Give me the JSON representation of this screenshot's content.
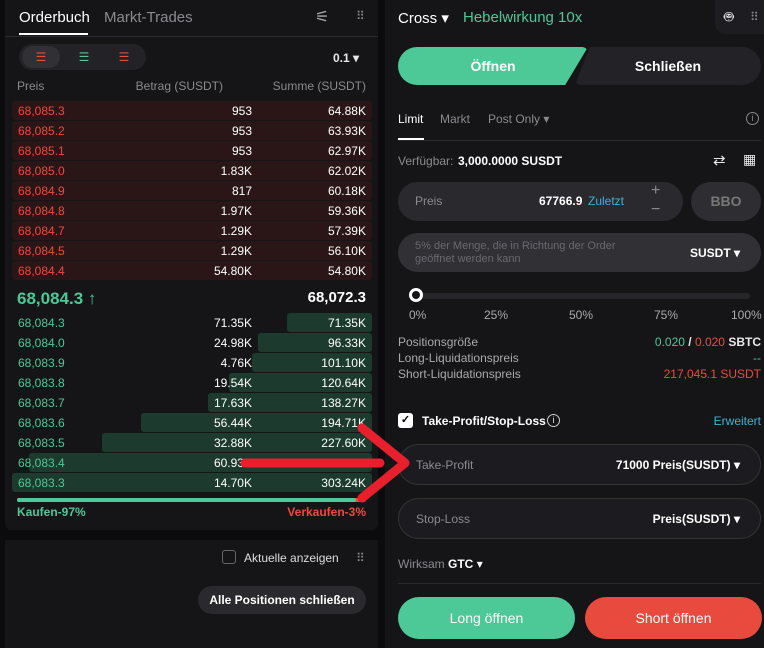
{
  "orderbook": {
    "tabs": [
      "Orderbuch",
      "Markt-Trades"
    ],
    "precision": "0.1",
    "headers": [
      "Preis",
      "Betrag (SUSDT)",
      "Summe (SUSDT)"
    ],
    "asks": [
      [
        "68,085.3",
        "953",
        "64.88K"
      ],
      [
        "68,085.2",
        "953",
        "63.93K"
      ],
      [
        "68,085.1",
        "953",
        "62.97K"
      ],
      [
        "68,085.0",
        "1.83K",
        "62.02K"
      ],
      [
        "68,084.9",
        "817",
        "60.18K"
      ],
      [
        "68,084.8",
        "1.97K",
        "59.36K"
      ],
      [
        "68,084.7",
        "1.29K",
        "57.39K"
      ],
      [
        "68,084.5",
        "1.29K",
        "56.10K"
      ],
      [
        "68,084.4",
        "54.80K",
        "54.80K"
      ]
    ],
    "last_price": "68,084.3",
    "mark_price": "68,072.3",
    "bids": [
      [
        "68,084.3",
        "71.35K",
        "71.35K"
      ],
      [
        "68,084.0",
        "24.98K",
        "96.33K"
      ],
      [
        "68,083.9",
        "4.76K",
        "101.10K"
      ],
      [
        "68,083.8",
        "19.54K",
        "120.64K"
      ],
      [
        "68,083.7",
        "17.63K",
        "138.27K"
      ],
      [
        "68,083.6",
        "56.44K",
        "194.71K"
      ],
      [
        "68,083.5",
        "32.88K",
        "227.60K"
      ],
      [
        "68,083.4",
        "60.93K",
        "288.53K"
      ],
      [
        "68,083.3",
        "14.70K",
        "303.24K"
      ]
    ],
    "buy_label": "Kaufen-97%",
    "sell_label": "Verkaufen-3%",
    "buy_percent": 97,
    "show_current": "Aktuelle anzeigen",
    "close_all": "Alle Positionen schließen"
  },
  "order": {
    "margin_mode": "Cross",
    "leverage": "Hebelwirkung 10x",
    "open": "Öffnen",
    "close": "Schließen",
    "types": [
      "Limit",
      "Markt",
      "Post Only"
    ],
    "available_label": "Verfügbar:",
    "available_value": "3,000.0000 SUSDT",
    "price_label": "Preis",
    "price_value": "67766.9",
    "price_latest": "Zuletzt",
    "bbo": "BBO",
    "amount_placeholder": "5% der Menge, die in Richtung der Order geöffnet werden kann",
    "amount_unit": "SUSDT",
    "slider_percent": 0,
    "slider_marks": [
      "0%",
      "25%",
      "50%",
      "75%",
      "100%"
    ],
    "position_size_label": "Positionsgröße",
    "position_long": "0.020",
    "position_short": "0.020",
    "position_unit": "SBTC",
    "long_liq_label": "Long-Liquidationspreis",
    "long_liq_value": "--",
    "short_liq_label": "Short-Liquidationspreis",
    "short_liq_value": "217,045.1 SUSDT",
    "tpsl_label": "Take-Profit/Stop-Loss",
    "tpsl_checked": true,
    "advanced": "Erweitert",
    "tp_label": "Take-Profit",
    "tp_value": "71000",
    "tp_unit": "Preis(SUSDT)",
    "sl_label": "Stop-Loss",
    "sl_unit": "Preis(SUSDT)",
    "tif_label": "Wirksam",
    "tif_value": "GTC",
    "long_btn": "Long öffnen",
    "short_btn": "Short öffnen"
  },
  "colors": {
    "green": "#4cc996",
    "red": "#ef4a3c",
    "annotation_arrow": "#e8202e"
  }
}
